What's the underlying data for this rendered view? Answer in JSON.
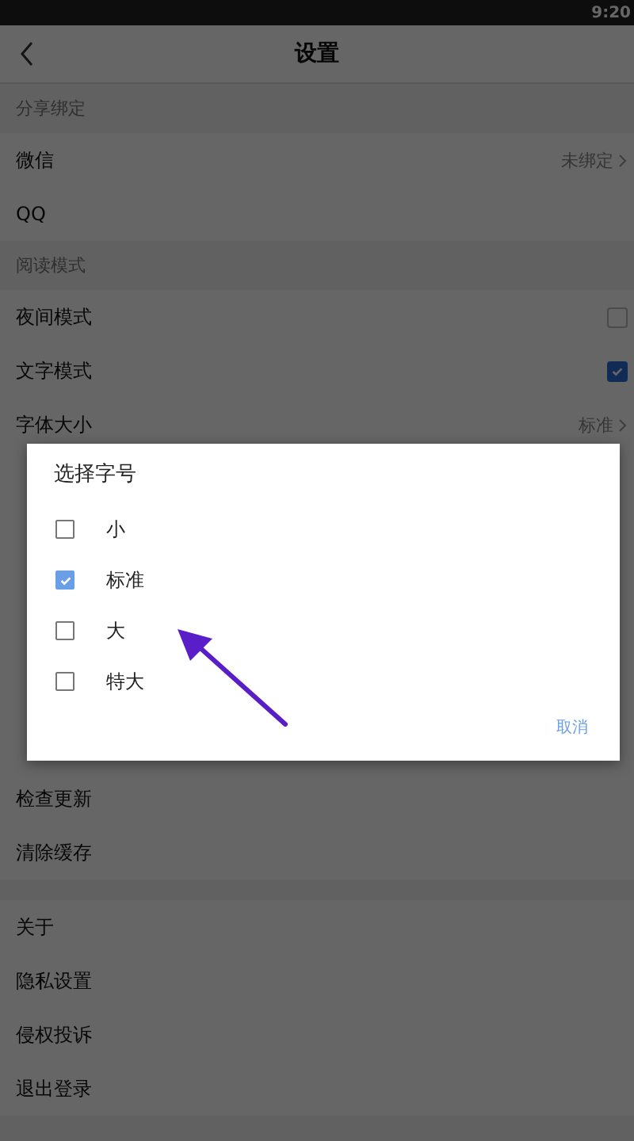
{
  "status_bar": {
    "time": "9:20"
  },
  "header": {
    "title": "设置"
  },
  "sections": [
    {
      "title": "分享绑定",
      "rows": [
        {
          "label": "微信",
          "value": "未绑定",
          "kind": "link"
        },
        {
          "label": "QQ",
          "kind": "plain"
        }
      ]
    },
    {
      "title": "阅读模式",
      "rows": [
        {
          "label": "夜间模式",
          "kind": "check",
          "checked": false
        },
        {
          "label": "文字模式",
          "kind": "check",
          "checked": true
        },
        {
          "label": "字体大小",
          "value": "标准",
          "kind": "link"
        }
      ]
    }
  ],
  "lower_rows": [
    {
      "label": "检查更新"
    },
    {
      "label": "清除缓存"
    }
  ],
  "bottom_rows": [
    {
      "label": "关于"
    },
    {
      "label": "隐私设置"
    },
    {
      "label": "侵权投诉"
    },
    {
      "label": "退出登录"
    }
  ],
  "dialog": {
    "title": "选择字号",
    "options": [
      {
        "label": "小",
        "selected": false
      },
      {
        "label": "标准",
        "selected": true
      },
      {
        "label": "大",
        "selected": false
      },
      {
        "label": "特大",
        "selected": false
      }
    ],
    "cancel": "取消"
  }
}
